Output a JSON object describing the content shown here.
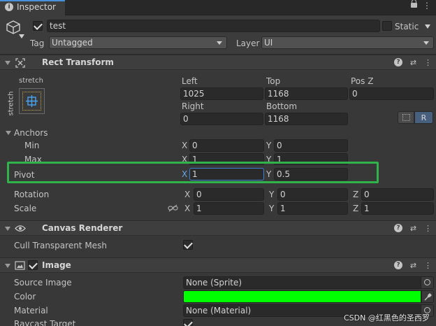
{
  "tab": {
    "title": "Inspector",
    "info_icon": "info-icon",
    "lock_icon": "lock-icon",
    "menu_icon": "kebab-menu-icon"
  },
  "gameobject": {
    "name": "test",
    "static_label": "Static",
    "tag_label": "Tag",
    "tag_value": "Untagged",
    "layer_label": "Layer",
    "layer_value": "UI"
  },
  "rect_transform": {
    "title": "Rect Transform",
    "preset_top_label": "stretch",
    "preset_side_label": "stretch",
    "left_label": "Left",
    "left_value": "1025",
    "top_label": "Top",
    "top_value": "1168",
    "posz_label": "Pos Z",
    "posz_value": "0",
    "right_label": "Right",
    "right_value": "0",
    "bottom_label": "Bottom",
    "bottom_value": "1168",
    "raw_button": "R",
    "anchors_label": "Anchors",
    "min_label": "Min",
    "min_x": "0",
    "min_y": "0",
    "max_label": "Max",
    "max_x": "1",
    "max_y": "1",
    "pivot_label": "Pivot",
    "pivot_x": "1",
    "pivot_y": "0.5",
    "rotation_label": "Rotation",
    "rotation_x": "0",
    "rotation_y": "0",
    "rotation_z": "0",
    "scale_label": "Scale",
    "scale_x": "1",
    "scale_y": "1",
    "scale_z": "1",
    "x_axis": "X",
    "y_axis": "Y",
    "z_axis": "Z"
  },
  "canvas_renderer": {
    "title": "Canvas Renderer",
    "cull_label": "Cull Transparent Mesh",
    "cull_checked": true
  },
  "image": {
    "title": "Image",
    "source_image_label": "Source Image",
    "source_image_value": "None (Sprite)",
    "color_label": "Color",
    "color_value": "#00ff00",
    "material_label": "Material",
    "material_value": "None (Material)",
    "raycast_label": "Raycast Target"
  },
  "watermark": "CSDN @红黑色的圣西罗",
  "highlight_color": "#2fb34a"
}
